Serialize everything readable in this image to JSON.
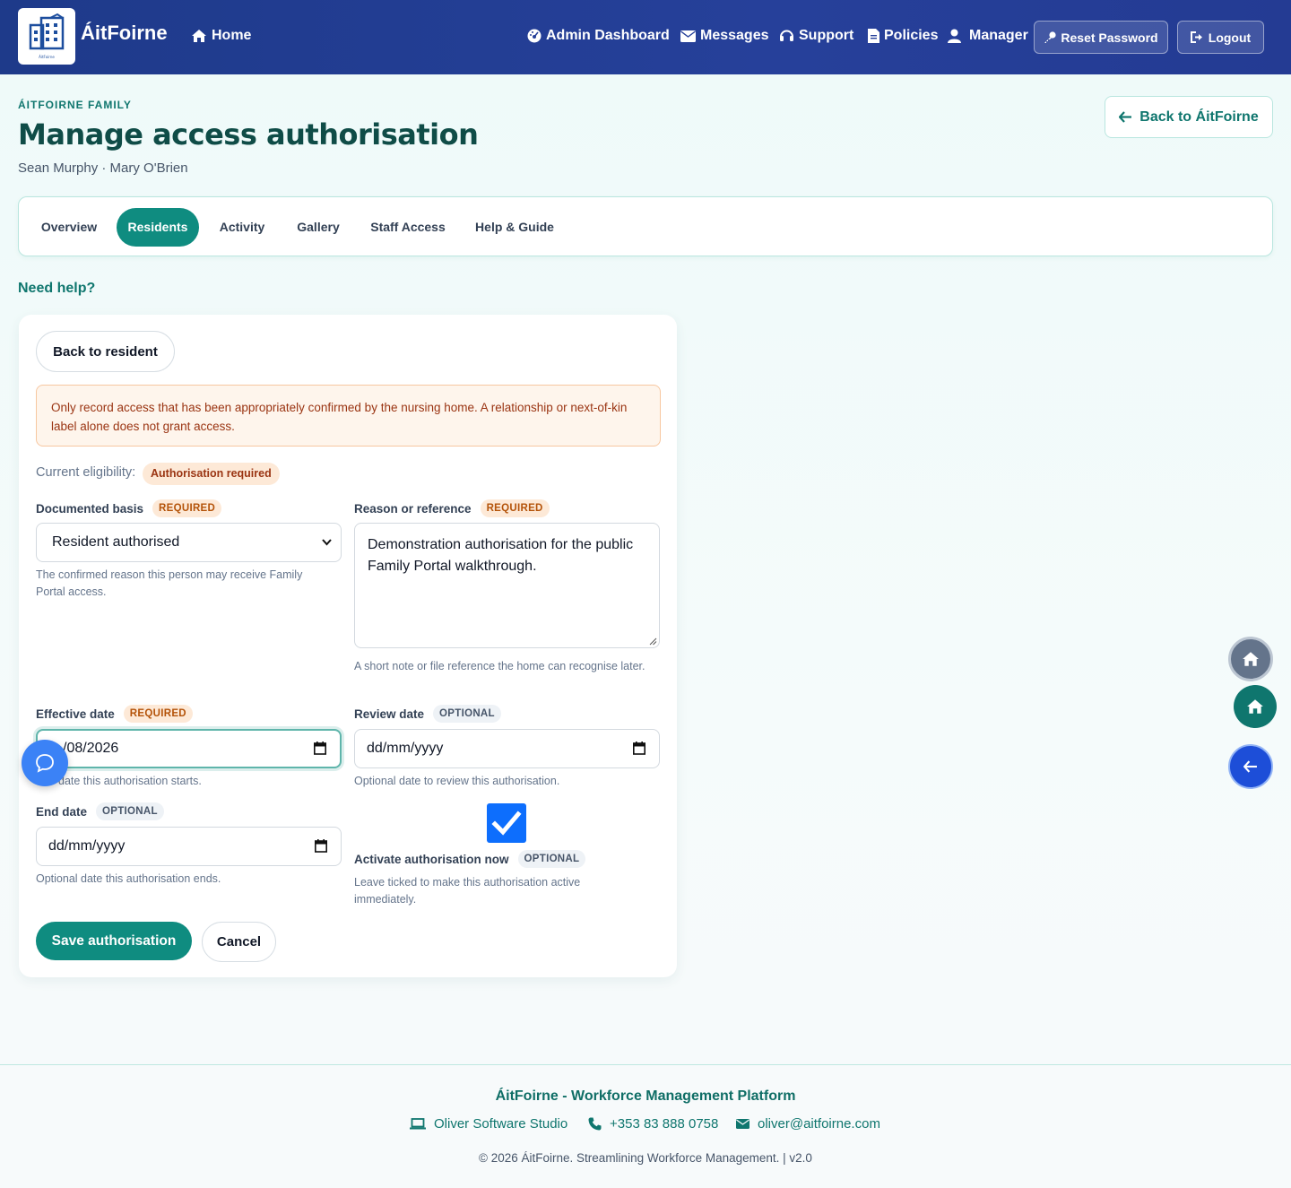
{
  "navbar": {
    "brand": "ÁitFoirne",
    "logo_text": "ÁitFoirne",
    "home": "Home",
    "admin_dashboard": "Admin Dashboard",
    "messages": "Messages",
    "support": "Support",
    "policies": "Policies",
    "manager": "Manager",
    "reset_password": "Reset Password",
    "logout": "Logout"
  },
  "header": {
    "eyebrow": "ÁITFOIRNE FAMILY",
    "title": "Manage access authorisation",
    "subtitle": "Sean Murphy · Mary O'Brien",
    "back_button": "Back to ÁitFoirne"
  },
  "tabs": [
    {
      "label": "Overview",
      "active": false
    },
    {
      "label": "Residents",
      "active": true
    },
    {
      "label": "Activity",
      "active": false
    },
    {
      "label": "Gallery",
      "active": false
    },
    {
      "label": "Staff Access",
      "active": false
    },
    {
      "label": "Help & Guide",
      "active": false
    }
  ],
  "need_help": "Need help?",
  "form": {
    "back_to_resident": "Back to resident",
    "warning": "Only record access that has been appropriately confirmed by the nursing home. A relationship or next-of-kin label alone does not grant access.",
    "eligibility_label": "Current eligibility:",
    "eligibility_value": "Authorisation required",
    "required_tag": "REQUIRED",
    "optional_tag": "OPTIONAL",
    "documented_basis": {
      "label": "Documented basis",
      "value": "Resident authorised",
      "help": "The confirmed reason this person may receive Family Portal access."
    },
    "reason": {
      "label": "Reason or reference",
      "value": "Demonstration authorisation for the public Family Portal walkthrough.",
      "help": "A short note or file reference the home can recognise later."
    },
    "effective_date": {
      "label": "Effective date",
      "value": "/08/2026",
      "help": "date this authorisation starts."
    },
    "review_date": {
      "label": "Review date",
      "placeholder": "dd/mm/yyyy",
      "help": "Optional date to review this authorisation."
    },
    "end_date": {
      "label": "End date",
      "placeholder": "dd/mm/yyyy",
      "help": "Optional date this authorisation ends."
    },
    "activate": {
      "label": "Activate authorisation now",
      "checked": true,
      "help": "Leave ticked to make this authorisation active immediately."
    },
    "save": "Save authorisation",
    "cancel": "Cancel"
  },
  "footer": {
    "title": "ÁitFoirne - Workforce Management Platform",
    "studio": "Oliver Software Studio",
    "phone": "+353 83 888 0758",
    "email": "oliver@aitfoirne.com",
    "copyright": "© 2026 ÁitFoirne. Streamlining Workforce Management. | v2.0"
  },
  "colors": {
    "navbar": "#1e3a8a",
    "accent": "#0f8c80",
    "fab_grey": "#64748b",
    "fab_teal": "#0f766e",
    "fab_blue": "#1d4ed8",
    "chat": "#3b82f6"
  }
}
